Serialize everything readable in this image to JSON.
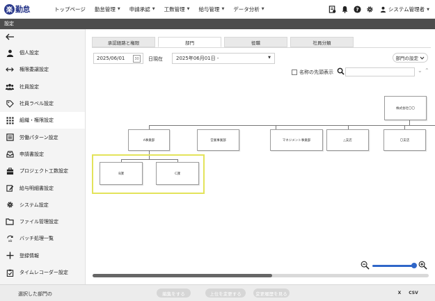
{
  "app": {
    "logo_char": "楽",
    "logo_text": "勤怠"
  },
  "nav": [
    {
      "label": "トップページ",
      "caret": false
    },
    {
      "label": "勤怠管理",
      "caret": true
    },
    {
      "label": "申請承認",
      "caret": true
    },
    {
      "label": "工数管理",
      "caret": true
    },
    {
      "label": "給与管理",
      "caret": true
    },
    {
      "label": "データ分析",
      "caret": true
    }
  ],
  "user": {
    "name": "システム管理者"
  },
  "page_title": "設定",
  "sidebar": {
    "items": [
      {
        "label": "個人設定",
        "icon": "person-icon"
      },
      {
        "label": "権限委譲設定",
        "icon": "arrows-icon"
      },
      {
        "label": "社員設定",
        "icon": "group-icon"
      },
      {
        "label": "社員ラベル設定",
        "icon": "tag-icon"
      },
      {
        "label": "組織・権限設定",
        "icon": "org-grid-icon"
      },
      {
        "label": "労働パターン設定",
        "icon": "list-icon"
      },
      {
        "label": "申請書設定",
        "icon": "tray-icon"
      },
      {
        "label": "プロジェクト工数設定",
        "icon": "project-icon"
      },
      {
        "label": "給与明細書設定",
        "icon": "edit-doc-icon"
      },
      {
        "label": "システム設定",
        "icon": "gear-icon"
      },
      {
        "label": "ファイル管理設定",
        "icon": "folder-icon"
      },
      {
        "label": "バッチ処理一覧",
        "icon": "batch-icon"
      },
      {
        "label": "登録情報",
        "icon": "plus-icon"
      },
      {
        "label": "タイムレコーダー設定",
        "icon": "clipboard-icon"
      }
    ]
  },
  "tabs": [
    "承認経路と権限",
    "部門",
    "役職",
    "社員分類"
  ],
  "filters": {
    "date": "2025/06/01",
    "calendar_text": "30",
    "asof_label": "日現在",
    "period": "2025年06月01日 -",
    "dept_setting": "部門の設定",
    "show_head_label": "名称の先頭表示"
  },
  "org": {
    "root": "株式会社〇〇",
    "level1": [
      "A事業部",
      "営業事業部",
      "マネジメント事業部",
      "△支店",
      "〇支店"
    ],
    "level2": [
      "B課",
      "C課"
    ]
  },
  "footer": {
    "selected_label": "選択した部門の",
    "edit": "編集をする",
    "change_parent": "上位を変更する",
    "history": "変更履歴を見る",
    "excel": "X",
    "csv": "CSV"
  },
  "colors": {
    "brand": "#2b3a8c",
    "highlight": "#e3e35a",
    "zoom": "#2f66c8"
  }
}
